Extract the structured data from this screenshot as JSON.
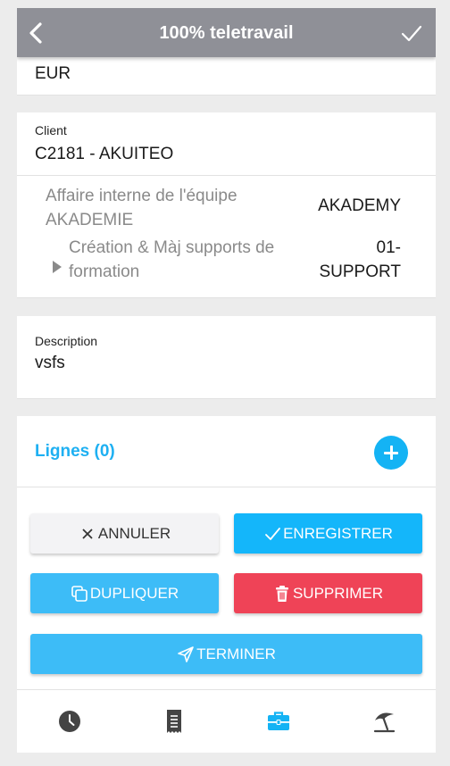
{
  "header": {
    "title": "100% teletravail",
    "back_icon": "chevron-left-icon",
    "confirm_icon": "check-icon",
    "color": "#8f9097"
  },
  "currency": {
    "value": "EUR"
  },
  "client": {
    "label": "Client",
    "value": "C2181 - AKUITEO"
  },
  "affaire": {
    "name": "Affaire interne de l'équipe AKADEMIE",
    "code": "AKADEMY",
    "tache": {
      "name": "Création & Màj supports de formation",
      "code": "01-SUPPORT"
    }
  },
  "description": {
    "label": "Description",
    "value": "vsfs"
  },
  "lignes": {
    "title": "Lignes (0)",
    "add_icon": "plus-circle-icon"
  },
  "actions": {
    "annuler": "ANNULER",
    "enregistrer": "ENREGISTRER",
    "dupliquer": "DUPLIQUER",
    "supprimer": "SUPPRIMER",
    "terminer": "TERMINER"
  },
  "tabbar": {
    "items": [
      {
        "icon": "clock-icon",
        "active": false
      },
      {
        "icon": "receipt-icon",
        "active": false
      },
      {
        "icon": "briefcase-icon",
        "active": true
      },
      {
        "icon": "beach-umbrella-icon",
        "active": false
      }
    ],
    "active_color": "#14b3f4",
    "inactive_color": "#444444"
  },
  "colors": {
    "accent": "#14b6fa",
    "danger": "#ef4357",
    "muted_text": "#8a8a8a"
  }
}
